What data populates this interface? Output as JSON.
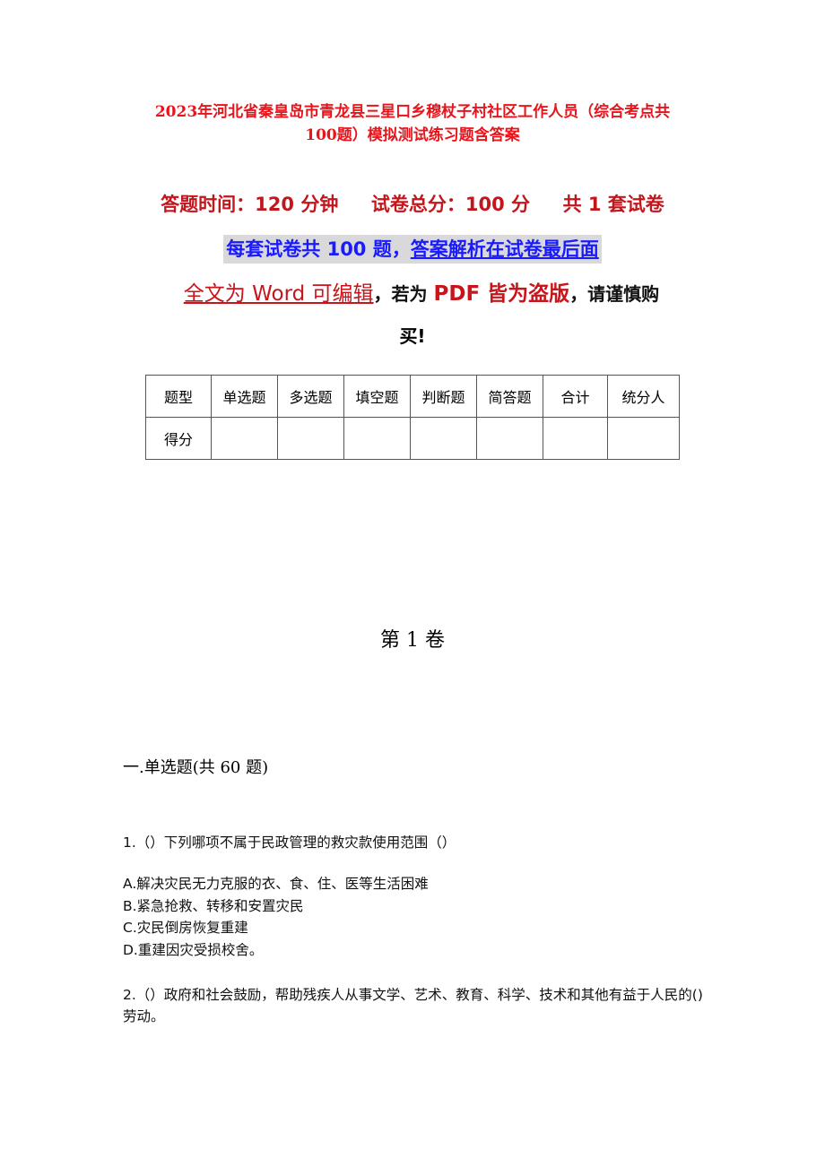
{
  "document": {
    "title_line1": "2023年河北省秦皇岛市青龙县三星口乡穆杖子村社区工作人员（综合考点共",
    "title_line2": "100题）模拟测试练习题含答案",
    "info_line": "答题时间：120 分钟     试卷总分：100 分     共 1 套试卷",
    "notice": {
      "part1": "每套试卷共 100 题，",
      "part2": "答案解析在试卷最后面"
    },
    "edit_notice": {
      "editable": "全文为 Word 可编辑",
      "comma1": "，若为 ",
      "pdf": "PDF 皆为盗版",
      "comma2": "，请谨慎购",
      "tail": "买!"
    },
    "score_table": {
      "headers": [
        "题型",
        "单选题",
        "多选题",
        "填空题",
        "判断题",
        "简答题",
        "合计",
        "统分人"
      ],
      "row_label": "得分",
      "row_values": [
        "",
        "",
        "",
        "",
        "",
        "",
        ""
      ]
    },
    "volume": "第 1 卷",
    "section_heading": "一.单选题(共 60 题)",
    "questions": [
      {
        "text": "1.（）下列哪项不属于民政管理的救灾款使用范围（）",
        "options": [
          "A.解决灾民无力克服的衣、食、住、医等生活困难",
          "B.紧急抢救、转移和安置灾民",
          "C.灾民倒房恢复重建",
          "D.重建因灾受损校舍。"
        ]
      },
      {
        "text": "2.（）政府和社会鼓励，帮助残疾人从事文学、艺术、教育、科学、技术和其他有益于人民的()劳动。"
      }
    ]
  }
}
